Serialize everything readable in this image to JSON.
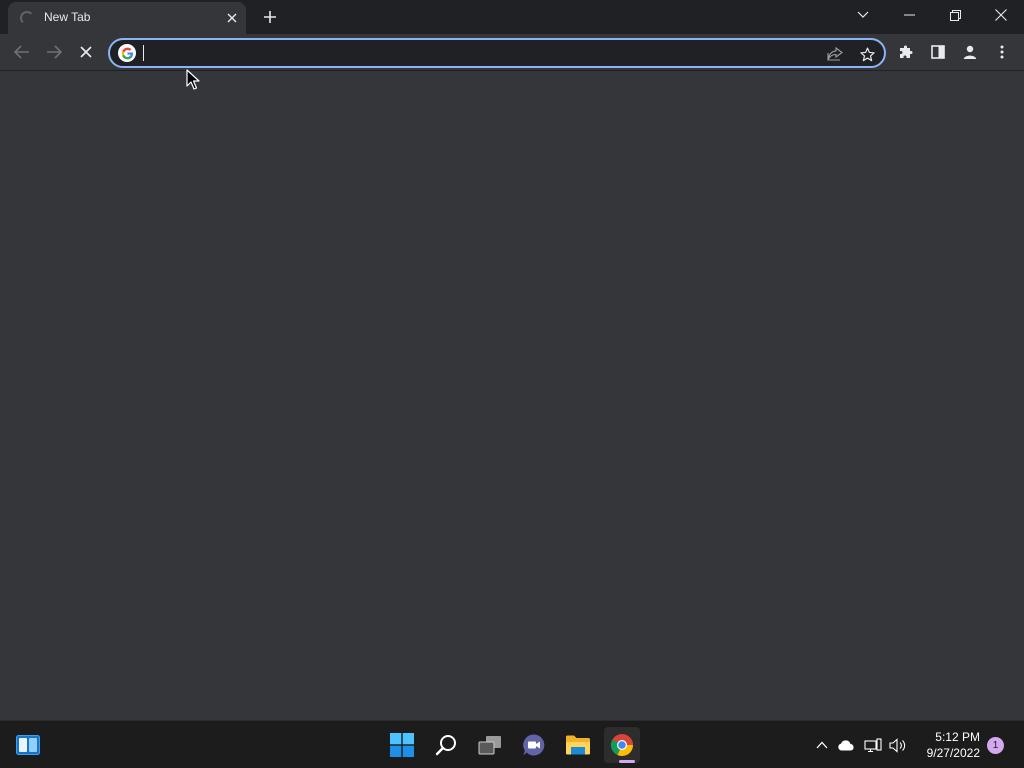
{
  "browser": {
    "tab": {
      "title": "New Tab",
      "state": "loading"
    },
    "omnibox": {
      "value": "",
      "placeholder": ""
    }
  },
  "icons": {
    "tab_spinner": "loading-spinner-icon",
    "tab_close": "close-icon",
    "new_tab": "plus-icon",
    "tab_search": "chevron-down-icon",
    "minimize": "minimize-icon",
    "restore": "restore-icon",
    "close_window": "close-icon",
    "back": "arrow-left-icon",
    "forward": "arrow-right-icon",
    "stop": "stop-x-icon",
    "google": "google-g-icon",
    "share": "share-icon",
    "bookmark": "star-icon",
    "extensions": "puzzle-icon",
    "side_panel": "side-panel-icon",
    "profile": "person-icon",
    "menu": "kebab-menu-icon"
  },
  "taskbar": {
    "apps": [
      "widgets",
      "start",
      "search",
      "task-view",
      "teams-chat",
      "file-explorer",
      "chrome"
    ],
    "active_app": "chrome",
    "clock": {
      "time": "5:12 PM",
      "date": "9/27/2022"
    },
    "notification_count": "1"
  },
  "colors": {
    "tabstrip_bg": "#202124",
    "toolbar_bg": "#35363a",
    "focus_ring": "#8ab4f8",
    "taskbar_bg": "#1c1c1c",
    "active_indicator": "#d2a8ee"
  }
}
